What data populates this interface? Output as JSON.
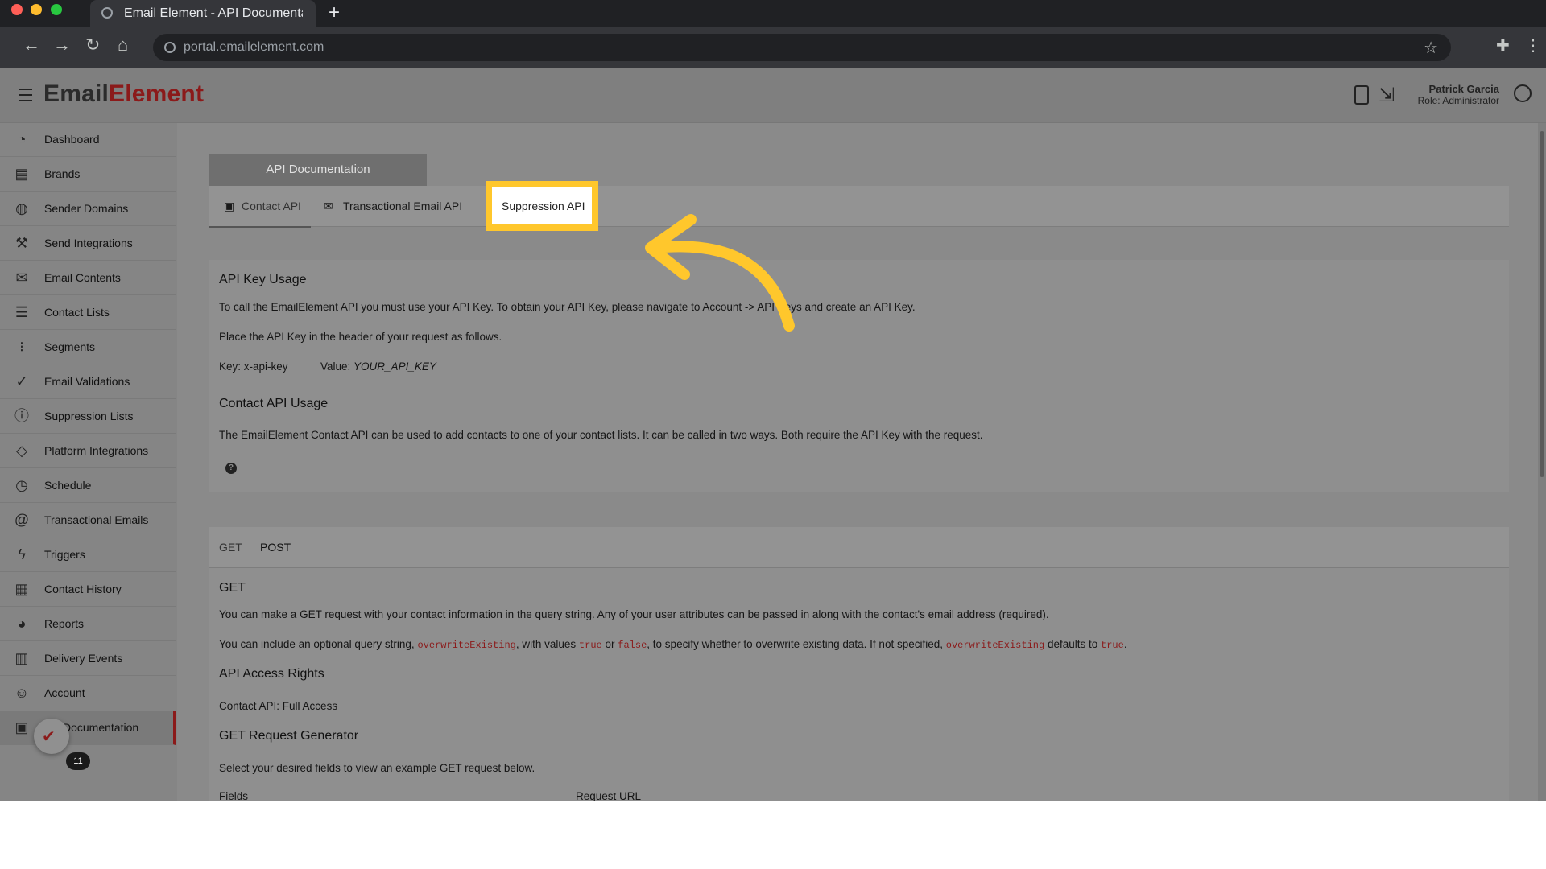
{
  "browser": {
    "tab_title": "Email Element - API Documentation",
    "url": "portal.emailelement.com"
  },
  "header": {
    "logo_part1": "EmailElement",
    "user_name": "Patrick Garcia",
    "user_role": "Role: Administrator"
  },
  "sidebar": {
    "items": [
      {
        "label": "Dashboard",
        "icon": "dashboard-icon"
      },
      {
        "label": "Brands",
        "icon": "brands-icon"
      },
      {
        "label": "Sender Domains",
        "icon": "globe-icon"
      },
      {
        "label": "Send Integrations",
        "icon": "wrench-icon"
      },
      {
        "label": "Email Contents",
        "icon": "envelope-icon"
      },
      {
        "label": "Contact Lists",
        "icon": "list-icon"
      },
      {
        "label": "Segments",
        "icon": "segments-icon"
      },
      {
        "label": "Email Validations",
        "icon": "check-circle-icon"
      },
      {
        "label": "Suppression Lists",
        "icon": "alert-circle-icon"
      },
      {
        "label": "Platform Integrations",
        "icon": "tag-icon"
      },
      {
        "label": "Schedule",
        "icon": "clock-icon"
      },
      {
        "label": "Transactional Emails",
        "icon": "at-icon"
      },
      {
        "label": "Triggers",
        "icon": "lightning-icon"
      },
      {
        "label": "Contact History",
        "icon": "clipboard-icon"
      },
      {
        "label": "Reports",
        "icon": "pie-icon"
      },
      {
        "label": "Delivery Events",
        "icon": "bars-icon"
      },
      {
        "label": "Account",
        "icon": "user-circle-icon"
      },
      {
        "label": "Documentation",
        "icon": "document-icon"
      }
    ],
    "badge_count": "11"
  },
  "main": {
    "api_title": "API Documentation",
    "tabs": [
      {
        "label": "Contact API"
      },
      {
        "label": "Transactional Email API"
      },
      {
        "label": "Suppression API"
      }
    ],
    "key_usage": {
      "heading": "API Key Usage",
      "p1": "To call the EmailElement API you must use your API Key. To obtain your API Key, please navigate to Account -> API Keys and create an API Key.",
      "p2": "Place the API Key in the header of your request as follows.",
      "key_label": "Key: x-api-key",
      "value_label": "Value:",
      "value_val": "YOUR_API_KEY",
      "contact_heading": "Contact API Usage",
      "contact_p": "The EmailElement Contact API can be used to add contacts to one of your contact lists. It can be called in two ways. Both require the API Key with the request."
    },
    "method_tabs": [
      "GET",
      "POST"
    ],
    "get_section": {
      "heading": "GET",
      "p1": "You can make a GET request with your contact information in the query string. Any of your user attributes can be passed in along with the contact's email address (required).",
      "p2_a": "You can include an optional query string,",
      "code1": "overwriteExisting",
      "p2_b": ", with values",
      "code_true": "true",
      "p2_or": "or",
      "code_false": "false",
      "p2_c": ", to specify whether to overwrite existing data. If not specified,",
      "code2": "overwriteExisting",
      "p2_d": "defaults to",
      "code_true2": "true",
      "p2_end": ".",
      "rights_heading": "API Access Rights",
      "rights_text": "Contact API: Full Access",
      "gen_heading": "GET Request Generator",
      "gen_text": "Select your desired fields to view an example GET request below.",
      "col_fields": "Fields",
      "col_url": "Request URL"
    }
  },
  "colors": {
    "highlight": "#ffc72c",
    "brand_red": "#8b1a1a"
  }
}
